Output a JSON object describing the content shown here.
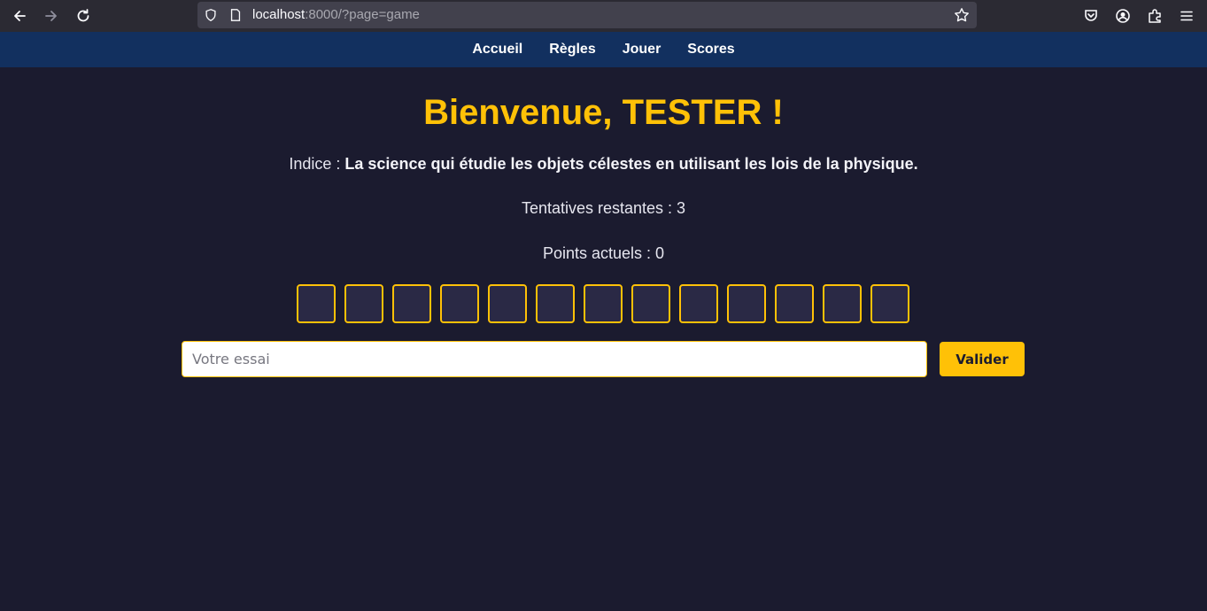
{
  "browser": {
    "url_host": "localhost",
    "url_rest": ":8000/?page=game",
    "icons": [
      "back-icon",
      "forward-icon",
      "reload-icon",
      "shield-icon",
      "page-icon",
      "bookmark-star-icon",
      "pocket-icon",
      "account-icon",
      "extensions-icon",
      "menu-icon"
    ]
  },
  "nav": {
    "items": [
      {
        "label": "Accueil"
      },
      {
        "label": "Règles"
      },
      {
        "label": "Jouer"
      },
      {
        "label": "Scores"
      }
    ]
  },
  "game": {
    "title": "Bienvenue, TESTER !",
    "hint_label": "Indice : ",
    "hint_text": "La science qui étudie les objets célestes en utilisant les lois de la physique.",
    "attempts_text": "Tentatives restantes : 3",
    "points_text": "Points actuels : 0",
    "letter_count": 13,
    "letters": [
      "",
      "",
      "",
      "",
      "",
      "",
      "",
      "",
      "",
      "",
      "",
      "",
      ""
    ],
    "input_placeholder": "Votre essai",
    "input_value": "",
    "submit_label": "Valider"
  },
  "colors": {
    "background": "#1b1b2f",
    "nav_bg": "#12305f",
    "accent": "#ffc107",
    "box_bg": "#2a2945"
  }
}
